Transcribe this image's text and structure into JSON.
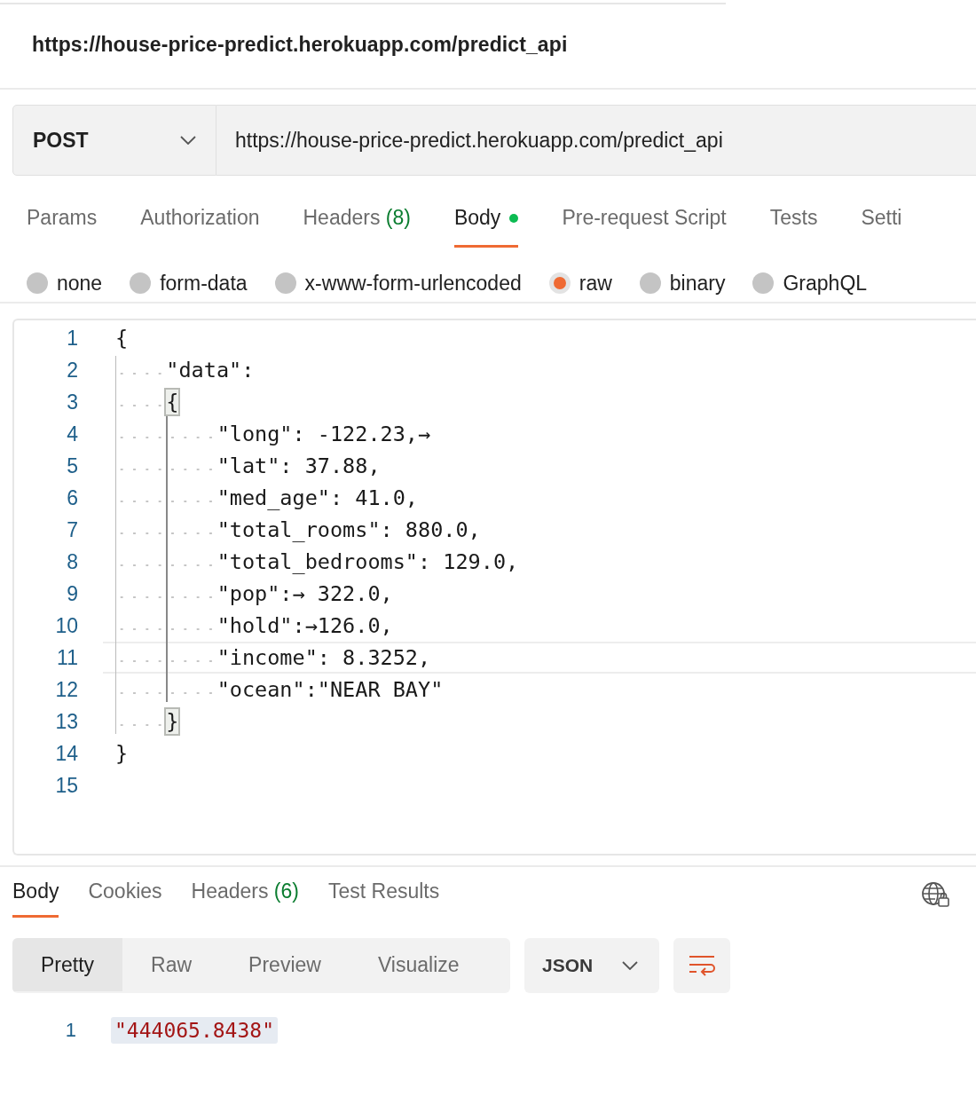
{
  "request_title": "https://house-price-predict.herokuapp.com/predict_api",
  "method": "POST",
  "url": "https://house-price-predict.herokuapp.com/predict_api",
  "request_tabs": [
    {
      "label": "Params",
      "selected": false
    },
    {
      "label": "Authorization",
      "selected": false
    },
    {
      "label": "Headers",
      "count": "(8)",
      "selected": false
    },
    {
      "label": "Body",
      "selected": true,
      "dot": true
    },
    {
      "label": "Pre-request Script",
      "selected": false
    },
    {
      "label": "Tests",
      "selected": false
    },
    {
      "label": "Setti",
      "selected": false
    }
  ],
  "body_types": [
    {
      "label": "none",
      "selected": false
    },
    {
      "label": "form-data",
      "selected": false
    },
    {
      "label": "x-www-form-urlencoded",
      "selected": false
    },
    {
      "label": "raw",
      "selected": true
    },
    {
      "label": "binary",
      "selected": false
    },
    {
      "label": "GraphQL",
      "selected": false
    }
  ],
  "editor": {
    "lines": [
      {
        "number": "1",
        "text": "{",
        "current": false,
        "matched": false
      },
      {
        "number": "2",
        "text": "    \"data\":",
        "current": false,
        "matched": false
      },
      {
        "number": "3",
        "text": "    {",
        "current": false,
        "matched": true
      },
      {
        "number": "4",
        "text": "        \"long\": -122.23,→",
        "current": false,
        "matched": false
      },
      {
        "number": "5",
        "text": "        \"lat\": 37.88,",
        "current": false,
        "matched": false
      },
      {
        "number": "6",
        "text": "        \"med_age\": 41.0,",
        "current": false,
        "matched": false
      },
      {
        "number": "7",
        "text": "        \"total_rooms\": 880.0,",
        "current": false,
        "matched": false
      },
      {
        "number": "8",
        "text": "        \"total_bedrooms\": 129.0,",
        "current": false,
        "matched": false
      },
      {
        "number": "9",
        "text": "        \"pop\":→ 322.0,",
        "current": false,
        "matched": false
      },
      {
        "number": "10",
        "text": "        \"hold\":→126.0,",
        "current": false,
        "matched": false
      },
      {
        "number": "11",
        "text": "        \"income\": 8.3252,",
        "current": true,
        "matched": false
      },
      {
        "number": "12",
        "text": "        \"ocean\":\"NEAR BAY\"",
        "current": false,
        "matched": false
      },
      {
        "number": "13",
        "text": "    }",
        "current": false,
        "matched": true
      },
      {
        "number": "14",
        "text": "}",
        "current": false,
        "matched": false
      },
      {
        "number": "15",
        "current": false
      }
    ]
  },
  "response_tabs": [
    {
      "label": "Body",
      "selected": true
    },
    {
      "label": "Cookies",
      "selected": false
    },
    {
      "label": "Headers",
      "count": "(6)",
      "selected": false
    },
    {
      "label": "Test Results",
      "selected": false
    }
  ],
  "view_modes": [
    {
      "label": "Pretty",
      "selected": true
    },
    {
      "label": "Raw",
      "selected": false
    },
    {
      "label": "Preview",
      "selected": false
    },
    {
      "label": "Visualize",
      "selected": false
    }
  ],
  "format": "JSON",
  "response": {
    "lines": [
      {
        "number": "1",
        "text": "\"444065.8438\""
      }
    ]
  }
}
